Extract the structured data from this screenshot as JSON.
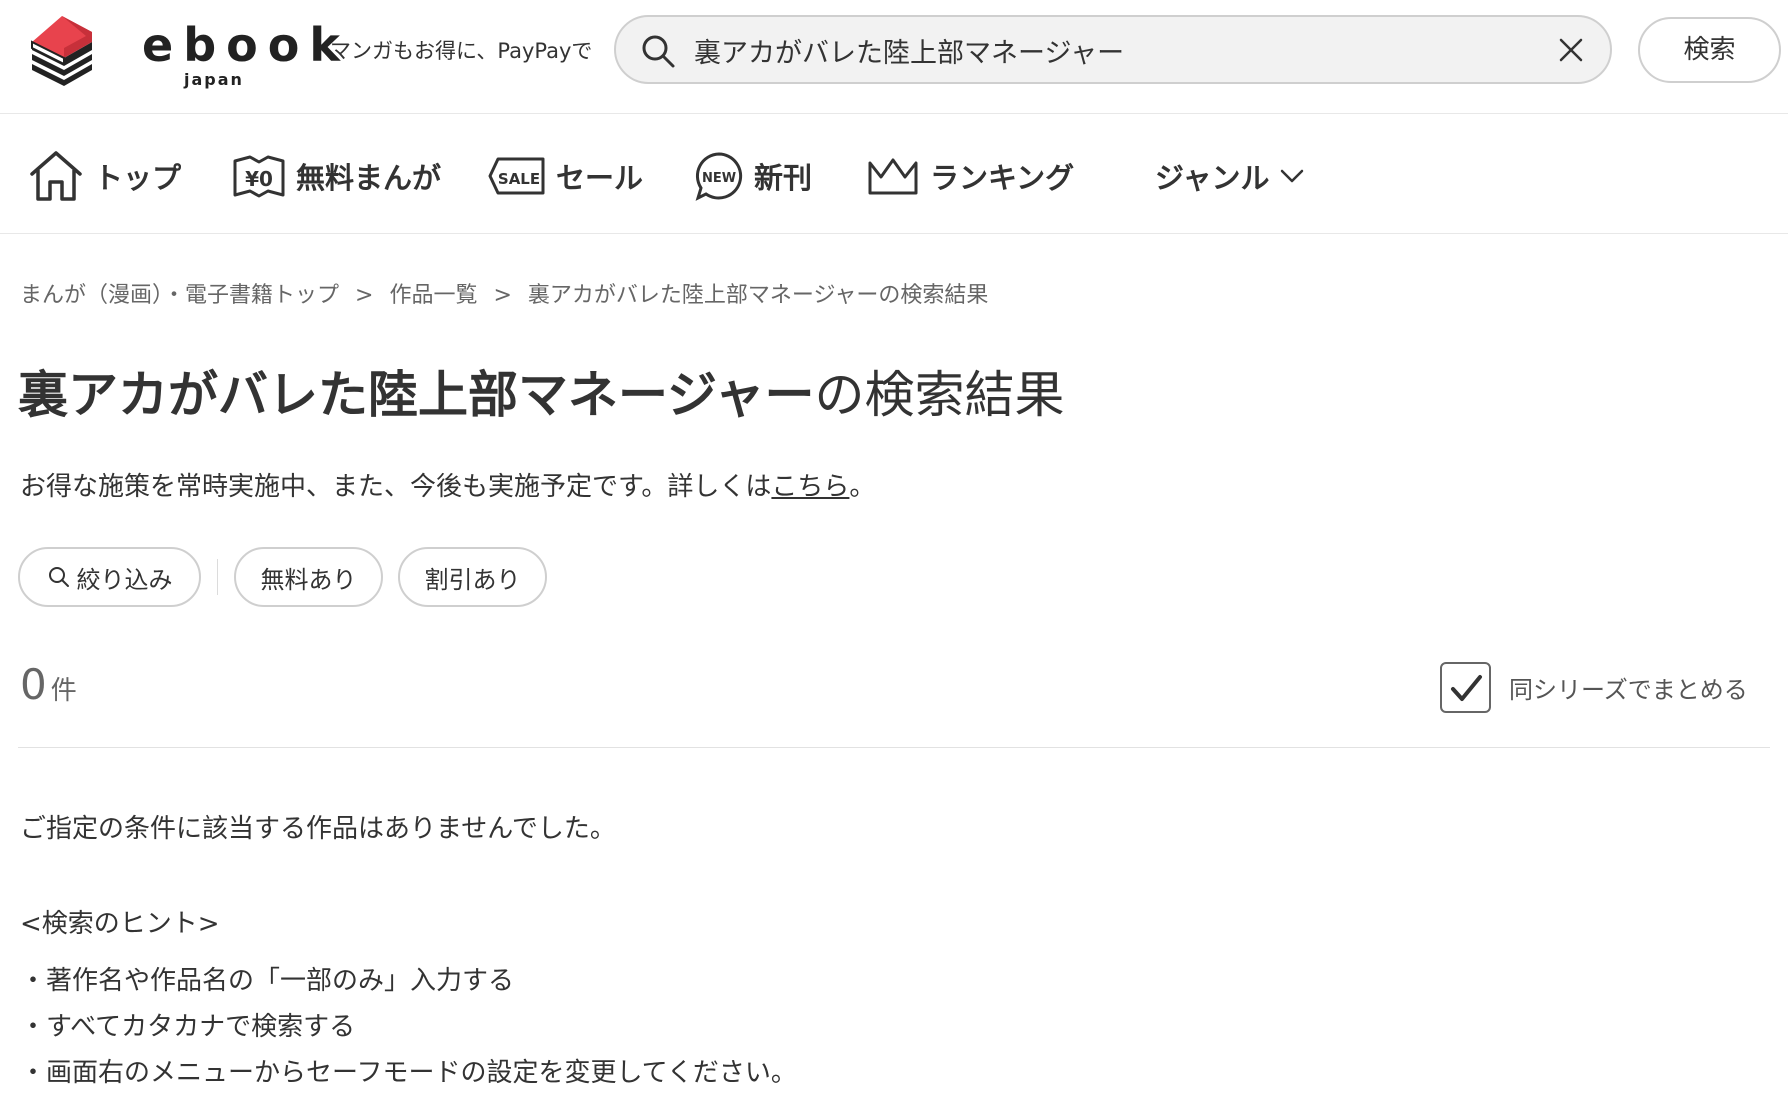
{
  "header": {
    "logo_text": "ebook",
    "logo_sub": "japan",
    "tagline": "マンガもお得に、PayPayで",
    "search_value": "裏アカがバレた陸上部マネージャー",
    "search_button": "検索",
    "brand_color": "#e8434d"
  },
  "nav": {
    "items": [
      {
        "label": "トップ",
        "icon": "home-icon"
      },
      {
        "label": "無料まんが",
        "icon": "free-yen-icon"
      },
      {
        "label": "セール",
        "icon": "sale-tag-icon"
      },
      {
        "label": "新刊",
        "icon": "new-badge-icon"
      },
      {
        "label": "ランキング",
        "icon": "crown-icon"
      },
      {
        "label": "ジャンル",
        "icon": "chevron-down-icon"
      }
    ],
    "free_badge": "¥0",
    "sale_badge": "SALE",
    "new_badge": "NEW"
  },
  "breadcrumb": {
    "items": [
      "まんが（漫画）・電子書籍トップ",
      "作品一覧",
      "裏アカがバレた陸上部マネージャーの検索結果"
    ],
    "separator": ">"
  },
  "title": {
    "keyword": "裏アカがバレた陸上部マネージャー",
    "suffix": "の検索結果"
  },
  "notice": {
    "text": "お得な施策を常時実施中、また、今後も実施予定です。詳しくは",
    "link": "こちら",
    "end": "。"
  },
  "filters": {
    "refine": "絞り込み",
    "free": "無料あり",
    "discount": "割引あり"
  },
  "results": {
    "count": "0",
    "unit": "件",
    "series_label": "同シリーズでまとめる",
    "series_checked": true
  },
  "empty": {
    "message": "ご指定の条件に該当する作品はありませんでした。",
    "hint_title": "<検索のヒント>",
    "hints": [
      "・著作名や作品名の「一部のみ」入力する",
      "・すべてカタカナで検索する",
      "・画面右のメニューからセーフモードの設定を変更してください。"
    ]
  }
}
